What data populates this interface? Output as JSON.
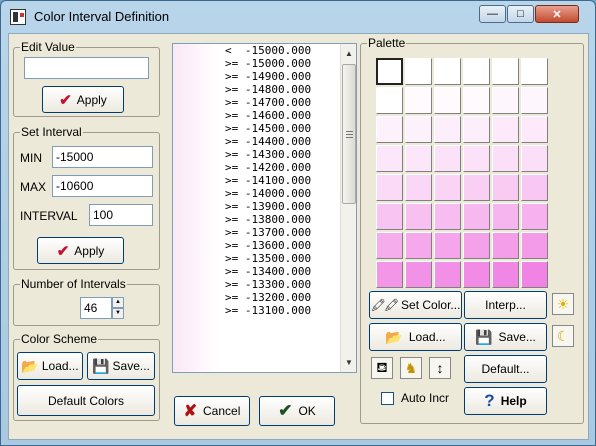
{
  "window": {
    "title": "Color Interval Definition",
    "min_glyph": "—",
    "max_glyph": "□",
    "close_glyph": "✕"
  },
  "edit_value": {
    "label": "Edit Value",
    "value": "",
    "apply_label": "Apply"
  },
  "set_interval": {
    "label": "Set Interval",
    "min_label": "MIN",
    "min_value": "-15000",
    "max_label": "MAX",
    "max_value": "-10600",
    "interval_label": "INTERVAL",
    "interval_value": "100",
    "apply_label": "Apply"
  },
  "num_intervals": {
    "label": "Number of Intervals",
    "value": "46"
  },
  "color_scheme": {
    "label": "Color Scheme",
    "load_label": "Load...",
    "save_label": "Save...",
    "default_label": "Default Colors"
  },
  "interval_list": [
    "<  -15000.000",
    ">= -15000.000",
    ">= -14900.000",
    ">= -14800.000",
    ">= -14700.000",
    ">= -14600.000",
    ">= -14500.000",
    ">= -14400.000",
    ">= -14300.000",
    ">= -14200.000",
    ">= -14100.000",
    ">= -14000.000",
    ">= -13900.000",
    ">= -13800.000",
    ">= -13700.000",
    ">= -13600.000",
    ">= -13500.000",
    ">= -13400.000",
    ">= -13300.000",
    ">= -13200.000",
    ">= -13100.000"
  ],
  "footer": {
    "cancel_label": "Cancel",
    "ok_label": "OK"
  },
  "palette": {
    "label": "Palette",
    "set_color_label": "Set Color...",
    "interp_label": "Interp...",
    "load_label": "Load...",
    "save_label": "Save...",
    "default_label": "Default...",
    "auto_incr_label": "Auto Incr",
    "auto_incr_checked": false,
    "help_label": "Help",
    "rows": [
      [
        "#ffffff",
        "#ffffff",
        "#ffffff",
        "#ffffff",
        "#ffffff",
        "#ffffff"
      ],
      [
        "#ffffff",
        "#fefafe",
        "#fefafe",
        "#fefafe",
        "#fef6fd",
        "#fef6fd"
      ],
      [
        "#fdf1fb",
        "#fdf1fb",
        "#fdeefb",
        "#fdeefb",
        "#fceafa",
        "#fceafa"
      ],
      [
        "#fce6f9",
        "#fce6f9",
        "#fbe2f8",
        "#fbe2f8",
        "#fbdef7",
        "#fbdef7"
      ],
      [
        "#fadaf6",
        "#fad7f6",
        "#fad3f5",
        "#f9cff4",
        "#f9cbf3",
        "#f9c7f3"
      ],
      [
        "#f8c4f2",
        "#f8c0f1",
        "#f7bcf0",
        "#f7b8ef",
        "#f7b5ef",
        "#f6b1ee"
      ],
      [
        "#f6adec",
        "#f5a9ec",
        "#f5a5eb",
        "#f4a1ea",
        "#f49de9",
        "#f39ae9"
      ],
      [
        "#f396e8",
        "#f292e7",
        "#f28fe6",
        "#f18be5",
        "#f187e4",
        "#f083e3"
      ]
    ]
  }
}
